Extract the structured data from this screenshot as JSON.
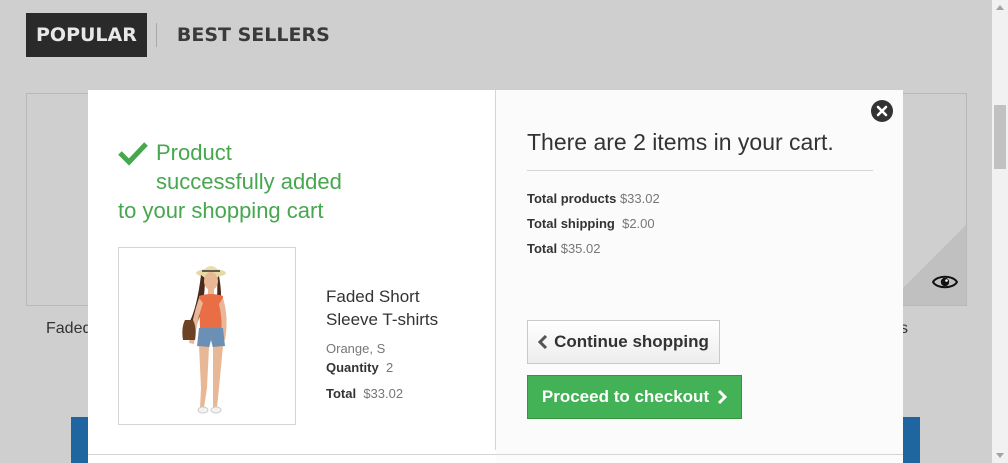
{
  "tabs": [
    {
      "label": "POPULAR",
      "active": true
    },
    {
      "label": "BEST SELLERS",
      "active": false
    }
  ],
  "background": {
    "product_left_name": "Faded",
    "product_right_name": "s",
    "eye_icon": "eye-icon"
  },
  "modal": {
    "success_line1": "Product",
    "success_line2": "successfully added",
    "success_line3": "to your shopping cart",
    "product": {
      "name_line1": "Faded Short",
      "name_line2": "Sleeve T-shirts",
      "attributes": "Orange, S",
      "quantity_label": "Quantity",
      "quantity_value": "2",
      "total_label": "Total",
      "total_value": "$33.02"
    },
    "cart": {
      "title": "There are 2 items in your cart.",
      "total_products_label": "Total products",
      "total_products_value": "$33.02",
      "total_shipping_label": "Total shipping",
      "total_shipping_value": "$2.00",
      "total_label": "Total",
      "total_value": "$35.02"
    },
    "buttons": {
      "continue_label": "Continue shopping",
      "checkout_label": "Proceed to checkout"
    },
    "icons": {
      "success": "check-icon",
      "close": "close-icon"
    }
  },
  "colors": {
    "success_green": "#46a74e",
    "checkout_green": "#43b155",
    "overlay_gray": "#cfcfcf"
  }
}
